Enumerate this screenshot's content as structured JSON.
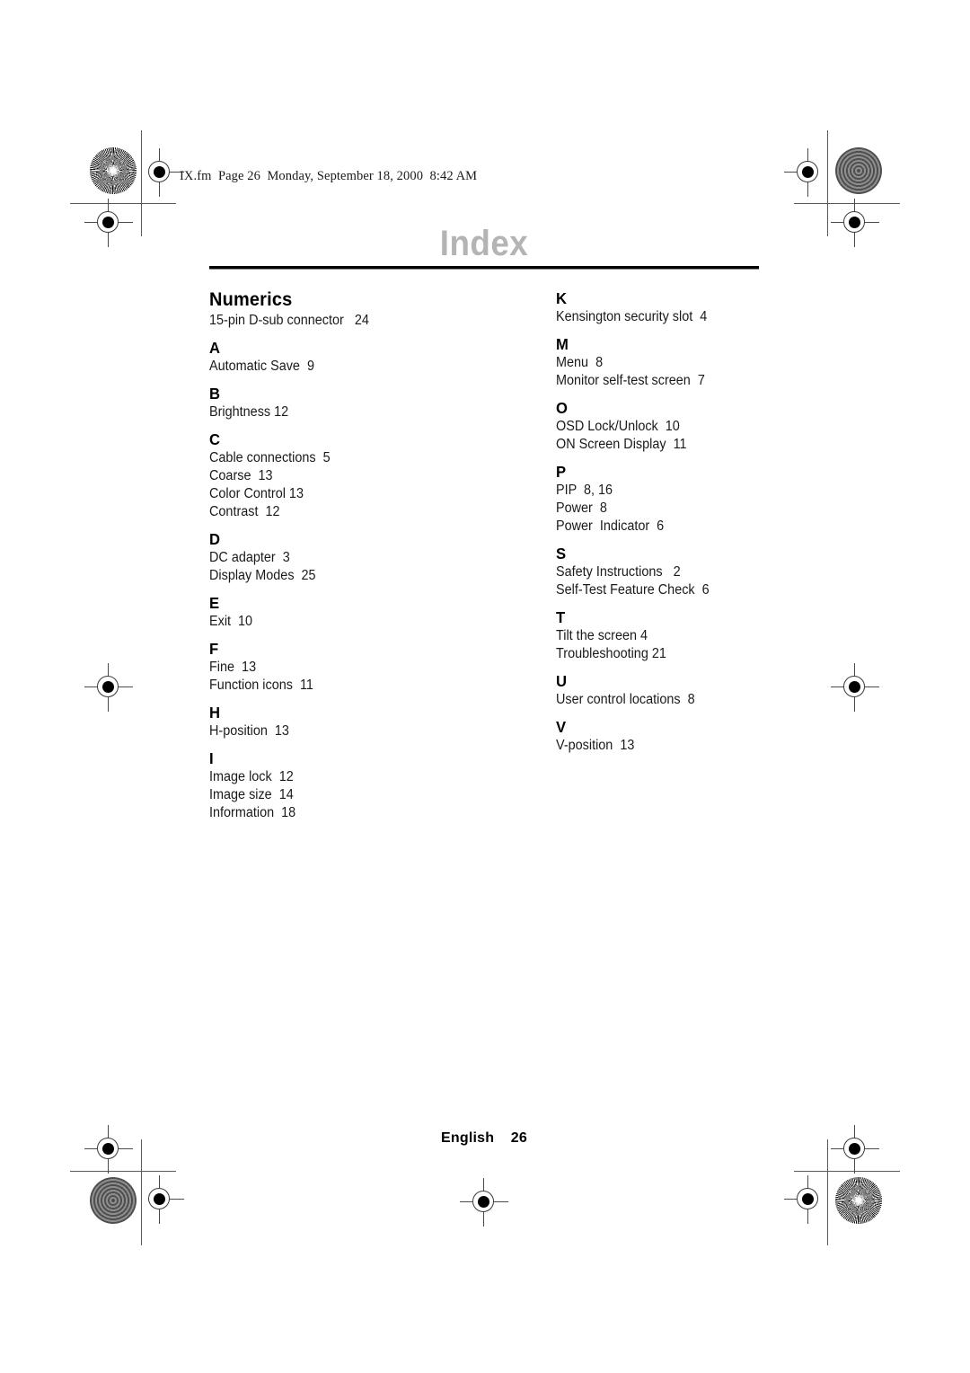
{
  "stamp": {
    "text": "IX.fm  Page 26  Monday, September 18, 2000  8:42 AM"
  },
  "page": {
    "title": "Index",
    "title_color": "#b4b4b4"
  },
  "columns": [
    {
      "side": "left",
      "groups": [
        {
          "letter": "Numerics",
          "is_wordmark": true,
          "entries": [
            "15-pin D-sub connector   24"
          ]
        },
        {
          "letter": "A",
          "is_wordmark": false,
          "entries": [
            "Automatic Save  9"
          ]
        },
        {
          "letter": "B",
          "is_wordmark": false,
          "entries": [
            "Brightness 12"
          ]
        },
        {
          "letter": "C",
          "is_wordmark": false,
          "entries": [
            "Cable connections  5",
            "Coarse  13",
            "Color Control 13",
            "Contrast  12"
          ]
        },
        {
          "letter": "D",
          "is_wordmark": false,
          "entries": [
            "DC adapter  3",
            "Display Modes  25"
          ]
        },
        {
          "letter": "E",
          "is_wordmark": false,
          "entries": [
            "Exit  10"
          ]
        },
        {
          "letter": "F",
          "is_wordmark": false,
          "entries": [
            "Fine  13",
            "Function icons  11"
          ]
        },
        {
          "letter": "H",
          "is_wordmark": false,
          "entries": [
            "H-position  13"
          ]
        },
        {
          "letter": "I",
          "is_wordmark": false,
          "entries": [
            "Image lock  12",
            "Image size  14",
            "Information  18"
          ]
        }
      ]
    },
    {
      "side": "right",
      "groups": [
        {
          "letter": "K",
          "is_wordmark": false,
          "entries": [
            "Kensington security slot  4"
          ]
        },
        {
          "letter": "M",
          "is_wordmark": false,
          "entries": [
            "Menu  8",
            "Monitor self-test screen  7"
          ]
        },
        {
          "letter": "O",
          "is_wordmark": false,
          "entries": [
            "OSD Lock/Unlock  10",
            "ON Screen Display  11"
          ]
        },
        {
          "letter": "P",
          "is_wordmark": false,
          "entries": [
            "PIP  8, 16",
            "Power  8",
            "Power  Indicator  6"
          ]
        },
        {
          "letter": "S",
          "is_wordmark": false,
          "entries": [
            "Safety Instructions   2",
            "Self-Test Feature Check  6"
          ]
        },
        {
          "letter": "T",
          "is_wordmark": false,
          "entries": [
            "Tilt the screen 4",
            "Troubleshooting 21"
          ]
        },
        {
          "letter": "U",
          "is_wordmark": false,
          "entries": [
            "User control locations  8"
          ]
        },
        {
          "letter": "V",
          "is_wordmark": false,
          "entries": [
            "V-position  13"
          ]
        }
      ]
    }
  ],
  "footer": {
    "text": "English    26"
  }
}
